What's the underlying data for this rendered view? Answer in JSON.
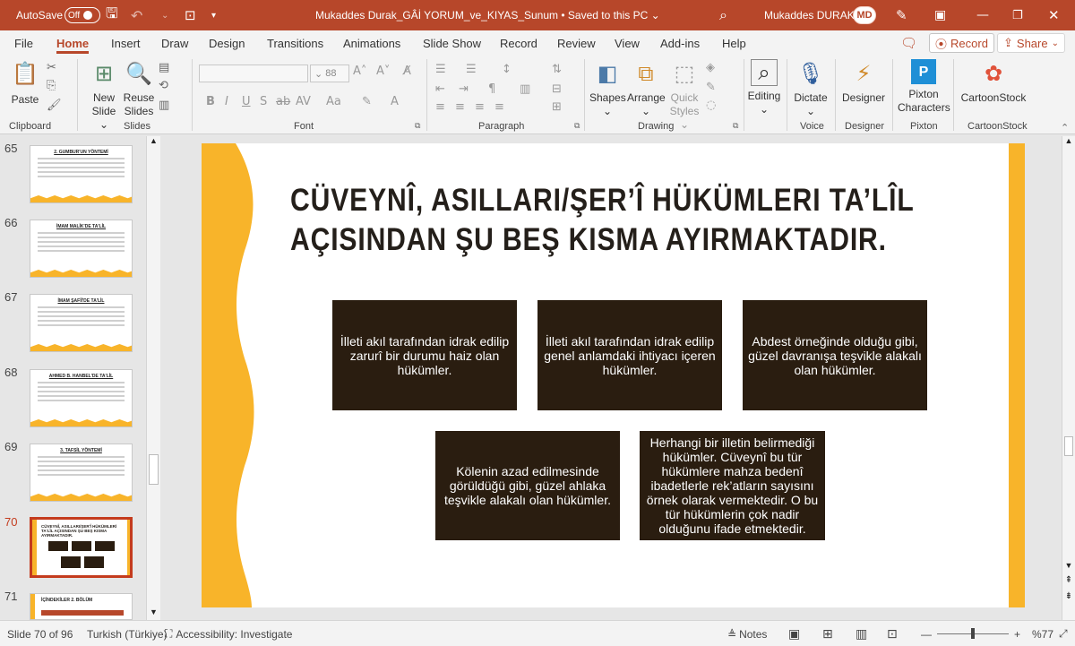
{
  "titlebar": {
    "autosave_label": "AutoSave",
    "autosave_state": "Off",
    "doc_title": "Mukaddes Durak_GÂİ YORUM_ve_KIYAS_Sunum",
    "saved_status": "Saved to this PC",
    "user_name": "Mukaddes DURAK",
    "user_initials": "MD",
    "accent": "#b7472a"
  },
  "menu": {
    "tabs": [
      "File",
      "Home",
      "Insert",
      "Draw",
      "Design",
      "Transitions",
      "Animations",
      "Slide Show",
      "Record",
      "Review",
      "View",
      "Add-ins",
      "Help"
    ],
    "active_tab": "Home",
    "record_button": "Record",
    "share_button": "Share"
  },
  "ribbon": {
    "paste": "Paste",
    "new_slide": [
      "New",
      "Slide"
    ],
    "reuse_slides": [
      "Reuse",
      "Slides"
    ],
    "font_size": "88",
    "format_letters": [
      "B",
      "I",
      "U",
      "S",
      "ab",
      "AV",
      "Aa"
    ],
    "shapes": "Shapes",
    "arrange": "Arrange",
    "quick_styles": [
      "Quick",
      "Styles"
    ],
    "editing": "Editing",
    "dictate": "Dictate",
    "designer": "Designer",
    "pixton": [
      "Pixton",
      "Characters"
    ],
    "cartoonstock": "CartoonStock",
    "groups": [
      "Clipboard",
      "Slides",
      "Font",
      "Paragraph",
      "Drawing",
      "Voice",
      "Designer",
      "Pixton",
      "CartoonStock"
    ]
  },
  "thumbnails": [
    {
      "num": "65",
      "title": "2. GUMBUR'UN YÖNTEMİ",
      "active": false
    },
    {
      "num": "66",
      "title": "İMAM MALİK'DE TA'LİL",
      "active": false
    },
    {
      "num": "67",
      "title": "İMAM ŞAFİİ'DE TA'LİL",
      "active": false
    },
    {
      "num": "68",
      "title": "AHMED B. HANBEL'DE TA'LİL",
      "active": false
    },
    {
      "num": "69",
      "title": "3. TAFSİL YÖNTEMİ",
      "active": false
    },
    {
      "num": "70",
      "title": "CÜVEYNÎ, ASILLARI/ŞER'Î HÜKÜMLERİ TA'LÎL AÇISINDAN ŞU BEŞ KISMA AYIRMAKTADIR.",
      "active": true
    },
    {
      "num": "71",
      "title": "İÇİNDEKİLER 2. BÖLÜM",
      "active": false
    }
  ],
  "slide": {
    "title_line1": "CÜVEYNÎ, ASILLARI/ŞER’Î HÜKÜMLERI TA’LÎL",
    "title_line2": "AÇISINDAN ŞU BEŞ KISMA AYIRMAKTADIR.",
    "boxes": [
      "İlleti akıl tarafından idrak edilip zarurî bir durumu haiz olan hükümler.",
      "İlleti akıl tarafından idrak edilip genel anlamdaki ihtiyacı içeren hükümler.",
      "Abdest örneğinde olduğu gibi, güzel davranışa teşvikle alakalı olan hükümler.",
      "Kölenin azad edilmesinde görüldüğü gibi, güzel ahlaka teşvikle alakalı olan hükümler.",
      "Herhangi bir illetin belirmediği hükümler. Cüveynî bu tür hükümlere mahza bedenî ibadetlerle rek’atların sayısını örnek olarak vermektedir. O bu tür hükümlerin çok nadir olduğunu ifade etmektedir."
    ],
    "accent_color": "#f8b42a",
    "box_color": "#2a1d10"
  },
  "status": {
    "slide_info": "Slide 70 of 96",
    "language": "Turkish (Türkiye)",
    "accessibility": "Accessibility: Investigate",
    "notes": "Notes",
    "zoom": "%77"
  }
}
